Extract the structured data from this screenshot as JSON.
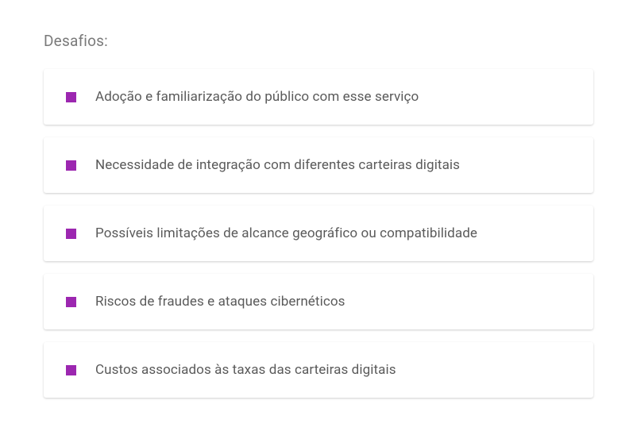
{
  "heading": "Desafios:",
  "accent_color": "#9c27b0",
  "items": [
    {
      "text": "Adoção e familiarização do público com esse serviço"
    },
    {
      "text": "Necessidade de integração com diferentes carteiras digitais"
    },
    {
      "text": "Possíveis limitações de alcance geográfico ou compatibilidade"
    },
    {
      "text": "Riscos de fraudes e ataques cibernéticos"
    },
    {
      "text": "Custos associados às taxas das carteiras digitais"
    }
  ]
}
